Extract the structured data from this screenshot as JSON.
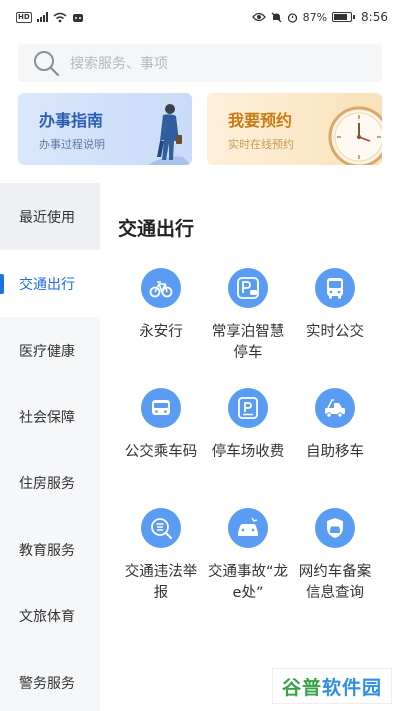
{
  "status_bar": {
    "battery_percent": "87%",
    "time": "8:56",
    "battery_level": 0.87
  },
  "search": {
    "placeholder": "搜索服务、事项"
  },
  "cards": [
    {
      "title": "办事指南",
      "subtitle": "办事过程说明"
    },
    {
      "title": "我要预约",
      "subtitle": "实时在线预约"
    }
  ],
  "sidebar": {
    "items": [
      {
        "label": "最近使用"
      },
      {
        "label": "交通出行",
        "active": true
      },
      {
        "label": "医疗健康"
      },
      {
        "label": "社会保障"
      },
      {
        "label": "住房服务"
      },
      {
        "label": "教育服务"
      },
      {
        "label": "文旅体育"
      },
      {
        "label": "警务服务"
      }
    ]
  },
  "main": {
    "section_title": "交通出行",
    "services": [
      {
        "label": "永安行",
        "icon": "bicycle-icon"
      },
      {
        "label": "常享泊智慧停车",
        "icon": "parking-icon"
      },
      {
        "label": "实时公交",
        "icon": "bus-icon"
      },
      {
        "label": "公交乘车码",
        "icon": "bus-qr-icon"
      },
      {
        "label": "停车场收费",
        "icon": "parking-fee-icon"
      },
      {
        "label": "自助移车",
        "icon": "tow-truck-icon"
      },
      {
        "label": "交通违法举报",
        "icon": "violation-report-icon"
      },
      {
        "label": "交通事故“龙e处”",
        "icon": "accident-icon"
      },
      {
        "label": "网约车备案信息查询",
        "icon": "ride-hailing-icon"
      }
    ]
  },
  "watermark": {
    "part1": "谷普",
    "part2": "软件园"
  },
  "colors": {
    "accent": "#1f6fe5",
    "icon_bg": "#5b9cf3",
    "sidebar_bg": "#f6f7f9"
  }
}
